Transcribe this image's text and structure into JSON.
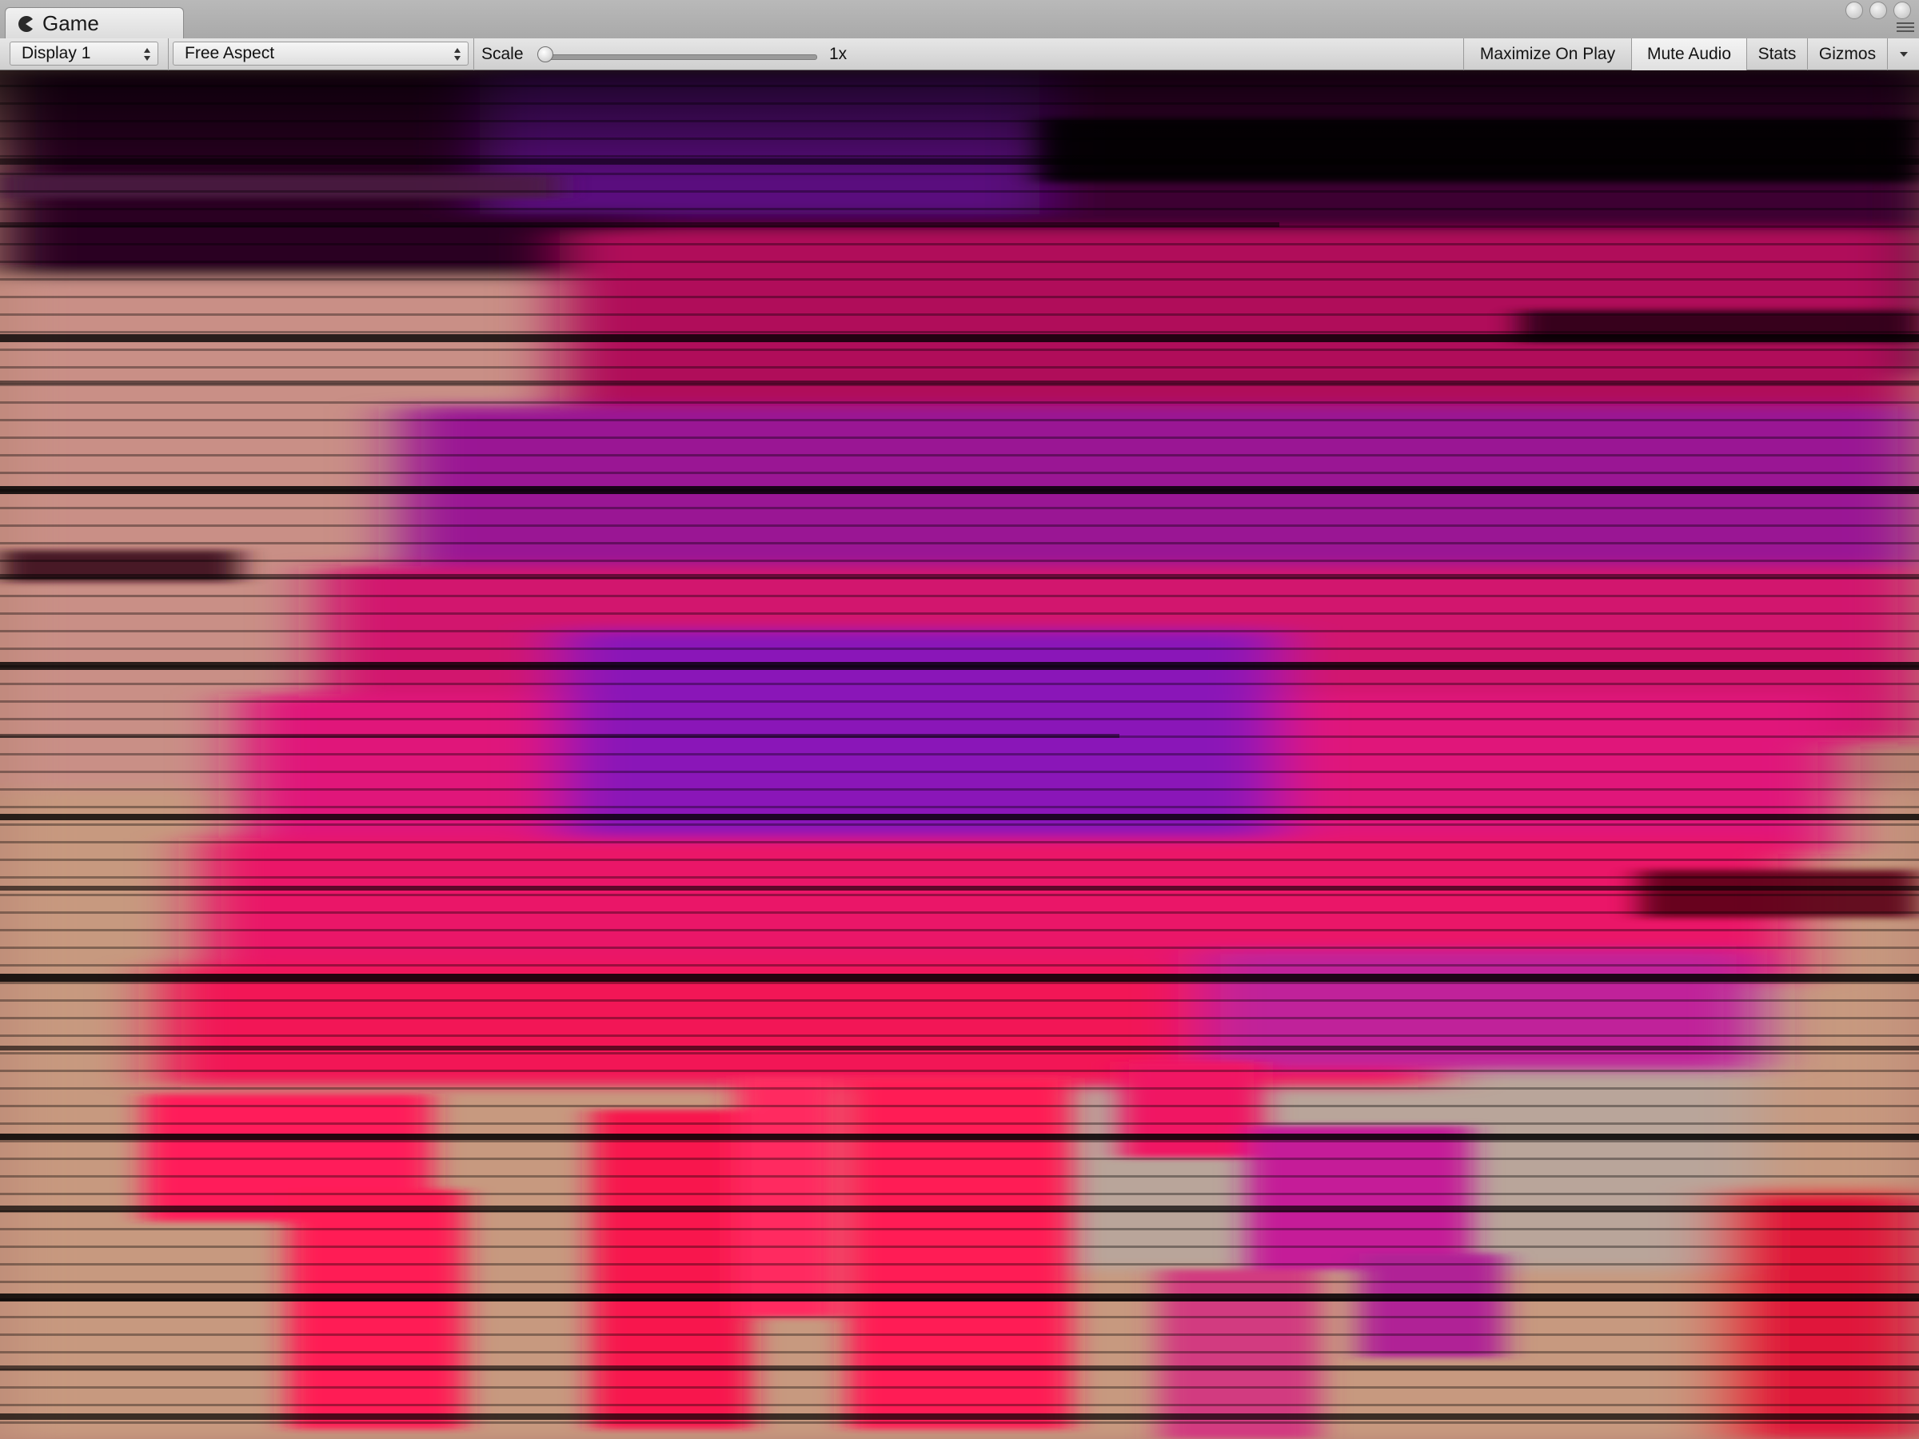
{
  "tab": {
    "title": "Game",
    "icon": "pacman-icon"
  },
  "toolbar": {
    "display": {
      "selected": "Display 1"
    },
    "aspect": {
      "selected": "Free Aspect"
    },
    "scale": {
      "label": "Scale",
      "value_label": "1x",
      "value": 1,
      "min": 1,
      "max": 5
    },
    "maximize_on_play": "Maximize On Play",
    "mute_audio": "Mute Audio",
    "stats": "Stats",
    "gizmos": "Gizmos"
  },
  "viewport": {
    "description_colors": {
      "magenta": "#d0127a",
      "hot_pink": "#ff1a5e",
      "purple": "#7a0fa8",
      "peach": "#d7957a",
      "black": "#000000"
    }
  }
}
